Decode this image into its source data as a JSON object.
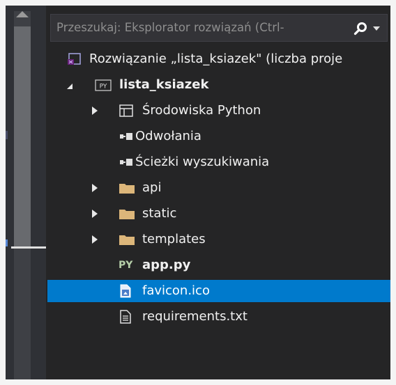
{
  "search": {
    "placeholder": "Przeszukaj: Eksplorator rozwiązań (Ctrl-"
  },
  "tree": {
    "solution": {
      "label": "Rozwiązanie „lista_ksiazek\" (liczba proje"
    },
    "project": {
      "label": "lista_ksiazek",
      "badge": "PY"
    },
    "items": [
      {
        "label": "Środowiska Python",
        "icon": "window-icon"
      },
      {
        "label": "Odwołania",
        "icon": "references-icon"
      },
      {
        "label": "Ścieżki wyszukiwania",
        "icon": "search-paths-icon"
      },
      {
        "label": "api",
        "icon": "folder-icon"
      },
      {
        "label": "static",
        "icon": "folder-icon"
      },
      {
        "label": "templates",
        "icon": "folder-icon"
      },
      {
        "label": "app.py",
        "icon": "python-file-icon",
        "badge": "PY"
      },
      {
        "label": "favicon.ico",
        "icon": "image-file-icon",
        "selected": true
      },
      {
        "label": "requirements.txt",
        "icon": "text-file-icon"
      }
    ]
  },
  "colors": {
    "selection": "#007acc",
    "background": "#252526",
    "folder": "#dcb67a"
  }
}
